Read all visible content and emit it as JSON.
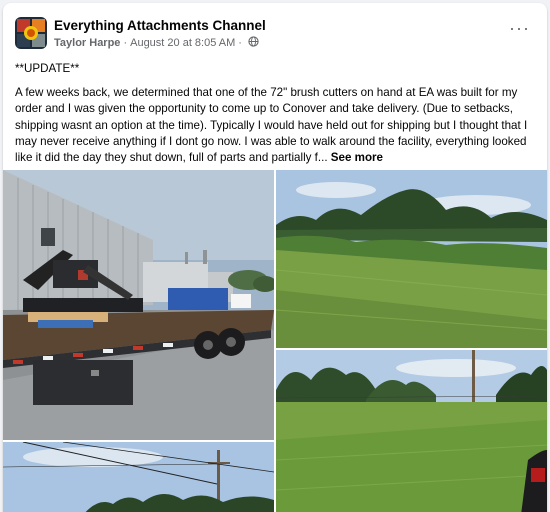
{
  "post": {
    "page_name": "Everything Attachments Channel",
    "author": "Taylor Harpe",
    "date": "August 20 at 8:05 AM",
    "separator": "·",
    "more_label": "···",
    "update_heading": "**UPDATE**",
    "body": "A few weeks back, we determined that one of the 72\" brush cutters on hand at EA was built for my order and I was given the opportunity to come up to Conover and take delivery. (Due to setbacks, shipping wasnt an option at the time). Typically I would have held out for shipping but I thought that I may never receive anything if I dont go now. I was able to walk around the facility, everything looked like it did the day they shut down, full of parts and partially f...",
    "see_more": "See more"
  },
  "icons": {
    "avatar": "channel-logo",
    "privacy": "globe-icon",
    "menu": "more-options-icon"
  },
  "photos": [
    {
      "name": "trailer-with-brush-cutter-photo"
    },
    {
      "name": "field-edge-trees-photo"
    },
    {
      "name": "mowed-field-photo"
    },
    {
      "name": "power-lines-sky-photo"
    }
  ]
}
